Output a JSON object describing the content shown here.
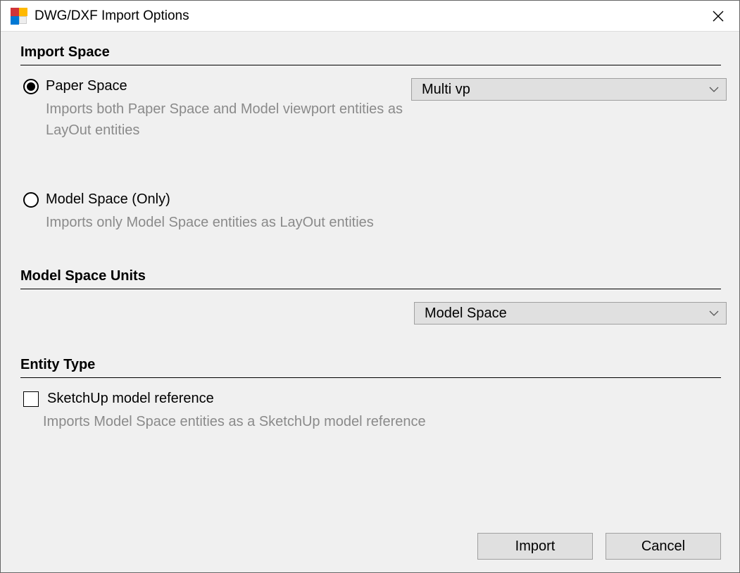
{
  "window": {
    "title": "DWG/DXF Import Options"
  },
  "sections": {
    "import_space": {
      "heading": "Import Space",
      "paper_space": {
        "label": "Paper Space",
        "desc": "Imports both Paper Space and Model viewport entities as LayOut entities",
        "dropdown": "Multi vp"
      },
      "model_space": {
        "label": "Model Space (Only)",
        "desc": "Imports only Model Space entities as LayOut entities"
      }
    },
    "model_space_units": {
      "heading": "Model Space Units",
      "dropdown": "Model Space"
    },
    "entity_type": {
      "heading": "Entity Type",
      "sketchup_ref": {
        "label": "SketchUp model reference",
        "desc": "Imports Model Space entities as a SketchUp model reference"
      }
    }
  },
  "buttons": {
    "import": "Import",
    "cancel": "Cancel"
  }
}
